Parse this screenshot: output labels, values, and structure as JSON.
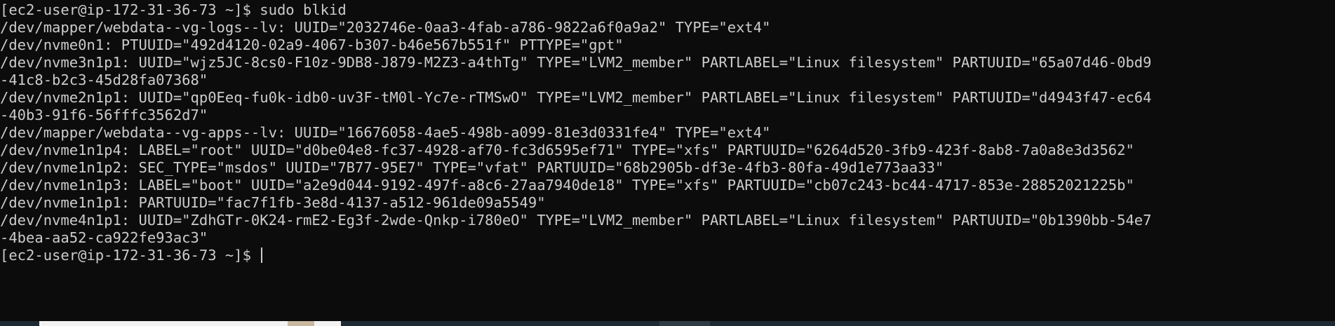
{
  "terminal": {
    "lines": [
      "[ec2-user@ip-172-31-36-73 ~]$ sudo blkid",
      "/dev/mapper/webdata--vg-logs--lv: UUID=\"2032746e-0aa3-4fab-a786-9822a6f0a9a2\" TYPE=\"ext4\"",
      "/dev/nvme0n1: PTUUID=\"492d4120-02a9-4067-b307-b46e567b551f\" PTTYPE=\"gpt\"",
      "/dev/nvme3n1p1: UUID=\"wjz5JC-8cs0-F10z-9DB8-J879-M2Z3-a4thTg\" TYPE=\"LVM2_member\" PARTLABEL=\"Linux filesystem\" PARTUUID=\"65a07d46-0bd9",
      "-41c8-b2c3-45d28fa07368\"",
      "/dev/nvme2n1p1: UUID=\"qp0Eeq-fu0k-idb0-uv3F-tM0l-Yc7e-rTMSwO\" TYPE=\"LVM2_member\" PARTLABEL=\"Linux filesystem\" PARTUUID=\"d4943f47-ec64",
      "-40b3-91f6-56fffc3562d7\"",
      "/dev/mapper/webdata--vg-apps--lv: UUID=\"16676058-4ae5-498b-a099-81e3d0331fe4\" TYPE=\"ext4\"",
      "/dev/nvme1n1p4: LABEL=\"root\" UUID=\"d0be04e8-fc37-4928-af70-fc3d6595ef71\" TYPE=\"xfs\" PARTUUID=\"6264d520-3fb9-423f-8ab8-7a0a8e3d3562\"",
      "/dev/nvme1n1p2: SEC_TYPE=\"msdos\" UUID=\"7B77-95E7\" TYPE=\"vfat\" PARTUUID=\"68b2905b-df3e-4fb3-80fa-49d1e773aa33\"",
      "/dev/nvme1n1p3: LABEL=\"boot\" UUID=\"a2e9d044-9192-497f-a8c6-27aa7940de18\" TYPE=\"xfs\" PARTUUID=\"cb07c243-bc44-4717-853e-28852021225b\"",
      "/dev/nvme1n1p1: PARTUUID=\"fac7f1fb-3e8d-4137-a512-961de09a5549\"",
      "/dev/nvme4n1p1: UUID=\"ZdhGTr-0K24-rmE2-Eg3f-2wde-Qnkp-i780eO\" TYPE=\"LVM2_member\" PARTLABEL=\"Linux filesystem\" PARTUUID=\"0b1390bb-54e7",
      "-4bea-aa52-ca922fe93ac3\""
    ],
    "prompt": "[ec2-user@ip-172-31-36-73 ~]$ "
  },
  "colors": {
    "background": "#0c0c0c",
    "foreground": "#cccccc"
  }
}
